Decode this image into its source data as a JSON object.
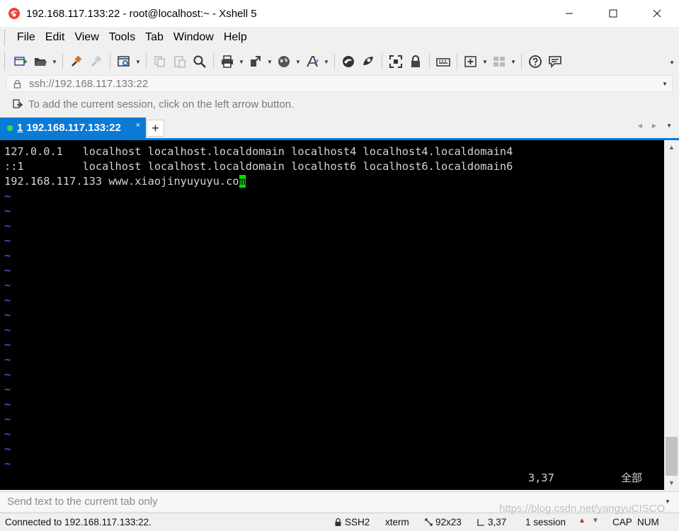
{
  "window": {
    "title": "192.168.117.133:22 - root@localhost:~ - Xshell 5"
  },
  "menu": [
    "File",
    "Edit",
    "View",
    "Tools",
    "Tab",
    "Window",
    "Help"
  ],
  "address_bar": {
    "value": "ssh://192.168.117.133:22"
  },
  "hint_bar": {
    "text": "To add the current session, click on the left arrow button."
  },
  "tabs": [
    {
      "number": "1",
      "label": "192.168.117.133:22",
      "close": "×",
      "active": true
    }
  ],
  "tab_add_label": "+",
  "terminal": {
    "lines": [
      "127.0.0.1   localhost localhost.localdomain localhost4 localhost4.localdomain4",
      "::1         localhost localhost.localdomain localhost6 localhost6.localdomain6",
      "192.168.117.133 www.xiaojinyuyuyu.co"
    ],
    "cursor_char": "m",
    "tilde": "~",
    "tilde_count": 19,
    "cursor_position": "3,37",
    "file_percent": "全部"
  },
  "send_bar": {
    "placeholder": "Send text to the current tab only"
  },
  "status_bar": {
    "connection": "Connected to 192.168.117.133:22.",
    "protocol": "SSH2",
    "terminal_type": "xterm",
    "size": "92x23",
    "cursor": "3,37",
    "sessions": "1 session",
    "cap": "CAP",
    "num": "NUM"
  },
  "watermark": "https://blog.csdn.net/yangyuCISCO",
  "colors": {
    "accent": "#0a7ad5",
    "terminal_bg": "#000000",
    "terminal_fg": "#d4d4d4",
    "tilde": "#3c57c8",
    "cursor": "#00e000",
    "tab_dot": "#3fdd3f"
  }
}
